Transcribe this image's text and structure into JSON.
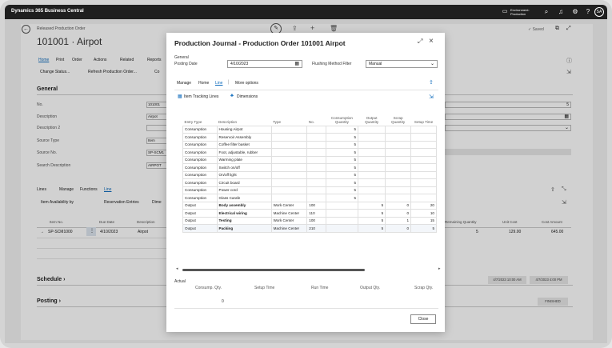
{
  "topbar": {
    "app_title": "Dynamics 365 Business Central",
    "environment_label": "Environment:",
    "environment_value": "Production",
    "avatar": "SA"
  },
  "background_page": {
    "breadcrumb": "Released Production Order",
    "title": "101001 · Airpot",
    "saved": "✓ Saved",
    "menu": [
      "Home",
      "Print",
      "Order",
      "Actions",
      "Related",
      "Reports"
    ],
    "actions": [
      "Change Status...",
      "Refresh Production Order...",
      "Co"
    ],
    "general_header": "General",
    "fields": [
      {
        "label": "No.",
        "value": "101001"
      },
      {
        "label": "Description",
        "value": "Airpot"
      },
      {
        "label": "Description 2",
        "value": ""
      },
      {
        "label": "Source Type",
        "value": "Item"
      },
      {
        "label": "Source No.",
        "value": "SP-SCM1"
      },
      {
        "label": "Search Description",
        "value": "AIRPOT"
      }
    ],
    "lines_menu": [
      "Lines",
      "Manage",
      "Functions",
      "Line"
    ],
    "lines_actions": [
      "Item Availability by",
      "Reservation Entries",
      "Dime"
    ],
    "lines_columns": [
      "Item No.",
      "Due Date",
      "Description"
    ],
    "lines_row": {
      "item_no": "SP-SCM1000",
      "due_date": "4/10/2023",
      "description": "Airpot"
    },
    "right_columns": [
      "Remaining Quantity",
      "Unit Cost",
      "Cost Amount"
    ],
    "right_values": [
      "5",
      "129.00",
      "645.00"
    ],
    "schedule_header": "Schedule",
    "posting_header": "Posting",
    "schedule_date": "4/7/2023 10:00 AM",
    "schedule_date2": "4/7/2023 4:00 PM",
    "status_badge": "FINISHED",
    "right_field_value": "5"
  },
  "modal": {
    "title": "Production Journal - Production Order 101001 Airpot",
    "general_label": "General",
    "posting_date_label": "Posting Date",
    "posting_date_value": "4/10/2023",
    "flushing_label": "Flushing Method Filter",
    "flushing_value": "Manual",
    "tabs": [
      "Manage",
      "Home",
      "Line",
      "More options"
    ],
    "actions": [
      "Item Tracking Lines",
      "Dimensions"
    ],
    "columns": [
      "Entry Type",
      "Description",
      "Type",
      "No.",
      "Consumption Quantity",
      "Output Quantity",
      "Scrap Quantity",
      "Setup Time"
    ],
    "rows": [
      {
        "entry_type": "Consumption",
        "description": "Housing Airpot",
        "type": "",
        "no": "",
        "consumption": "5",
        "output": "",
        "scrap": "",
        "setup": "",
        "bold": false
      },
      {
        "entry_type": "Consumption",
        "description": "Reservoir Assembly",
        "type": "",
        "no": "",
        "consumption": "5",
        "output": "",
        "scrap": "",
        "setup": "",
        "bold": false
      },
      {
        "entry_type": "Consumption",
        "description": "Coffee filter basket",
        "type": "",
        "no": "",
        "consumption": "5",
        "output": "",
        "scrap": "",
        "setup": "",
        "bold": false
      },
      {
        "entry_type": "Consumption",
        "description": "Foot, adjustable, rubber",
        "type": "",
        "no": "",
        "consumption": "5",
        "output": "",
        "scrap": "",
        "setup": "",
        "bold": false
      },
      {
        "entry_type": "Consumption",
        "description": "Warming plate",
        "type": "",
        "no": "",
        "consumption": "5",
        "output": "",
        "scrap": "",
        "setup": "",
        "bold": false
      },
      {
        "entry_type": "Consumption",
        "description": "Switch on/off",
        "type": "",
        "no": "",
        "consumption": "5",
        "output": "",
        "scrap": "",
        "setup": "",
        "bold": false
      },
      {
        "entry_type": "Consumption",
        "description": "On/off light",
        "type": "",
        "no": "",
        "consumption": "5",
        "output": "",
        "scrap": "",
        "setup": "",
        "bold": false
      },
      {
        "entry_type": "Consumption",
        "description": "Circuit board",
        "type": "",
        "no": "",
        "consumption": "5",
        "output": "",
        "scrap": "",
        "setup": "",
        "bold": false
      },
      {
        "entry_type": "Consumption",
        "description": "Power cord",
        "type": "",
        "no": "",
        "consumption": "5",
        "output": "",
        "scrap": "",
        "setup": "",
        "bold": false
      },
      {
        "entry_type": "Consumption",
        "description": "Glass Carafe",
        "type": "",
        "no": "",
        "consumption": "5",
        "output": "",
        "scrap": "",
        "setup": "",
        "bold": false
      },
      {
        "entry_type": "Output",
        "description": "Body assembly",
        "type": "Work Center",
        "no": "100",
        "consumption": "",
        "output": "5",
        "scrap": "0",
        "setup": "20",
        "bold": true
      },
      {
        "entry_type": "Output",
        "description": "Electrical wiring",
        "type": "Machine Center",
        "no": "110",
        "consumption": "",
        "output": "5",
        "scrap": "0",
        "setup": "10",
        "bold": true
      },
      {
        "entry_type": "Output",
        "description": "Testing",
        "type": "Work Center",
        "no": "100",
        "consumption": "",
        "output": "5",
        "scrap": "1",
        "setup": "15",
        "bold": true
      },
      {
        "entry_type": "Output",
        "description": "Packing",
        "type": "Machine Center",
        "no": "210",
        "consumption": "",
        "output": "5",
        "scrap": "0",
        "setup": "5",
        "bold": true
      }
    ],
    "actual_label": "Actual",
    "actual_columns": [
      "Consump. Qty.",
      "Setup Time",
      "Run Time",
      "Output Qty.",
      "Scrap Qty."
    ],
    "actual_values": [
      "0",
      "",
      "",
      "",
      ""
    ],
    "close_label": "Close"
  }
}
